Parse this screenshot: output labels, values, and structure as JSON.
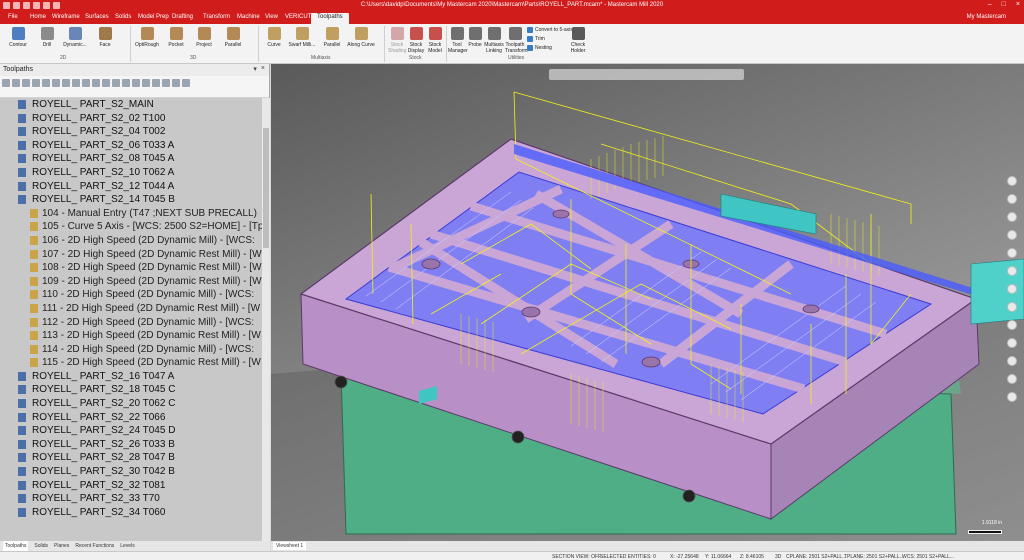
{
  "window": {
    "title": "C:\\Users\\davidp\\Documents\\My Mastercam 2020\\Mastercam\\Parts\\ROYELL_PART.mcam* - Mastercam Mill 2020",
    "controls": [
      "–",
      "□",
      "×"
    ]
  },
  "menu_tabs": [
    "File",
    "Home",
    "Wireframe",
    "Surfaces",
    "Solids",
    "Model Prep",
    "Drafting",
    "Transform",
    "Machine",
    "View",
    "VERICUT",
    "Toolpaths"
  ],
  "active_tab": "Toolpaths",
  "account": "My Mastercam",
  "ribbon": {
    "groups": {
      "g2d": "2D",
      "g3d": "3D",
      "multiaxis": "Multiaxis",
      "stock": "Stock",
      "utilities": "Utilities"
    },
    "buttons_2d": [
      "Contour",
      "Drill",
      "Dynamic...",
      "Face"
    ],
    "buttons_3d": [
      "OptiRough",
      "Pocket",
      "Project",
      "Parallel"
    ],
    "buttons_multiaxis": [
      "Curve",
      "Swarf Milli...",
      "Parallel",
      "Along Curve"
    ],
    "buttons_stock": [
      "Stock Shading",
      "Stock Display",
      "Stock Model"
    ],
    "buttons_utilities": [
      "Tool Manager",
      "Probe",
      "Multiaxis Linking",
      "Toolpath Transform"
    ],
    "small_items": [
      "Convert to 5-axis",
      "Trim",
      "Nesting"
    ],
    "check_holder": "Check Holder"
  },
  "toolpaths_panel": {
    "title": "Toolpaths",
    "rows": [
      {
        "text": "ROYELL_ PART_S2_MAIN",
        "sub": false
      },
      {
        "text": "ROYELL_ PART_S2_02 T100",
        "sub": false
      },
      {
        "text": "ROYELL_ PART_S2_04 T002",
        "sub": false
      },
      {
        "text": "ROYELL_ PART_S2_06 T033 A",
        "sub": false
      },
      {
        "text": "ROYELL_ PART_S2_08 T045 A",
        "sub": false
      },
      {
        "text": "ROYELL_ PART_S2_10 T062 A",
        "sub": false
      },
      {
        "text": "ROYELL_ PART_S2_12 T044 A",
        "sub": false
      },
      {
        "text": "ROYELL_ PART_S2_14 T045 B",
        "sub": false
      },
      {
        "text": "104 - Manual Entry (T47 ;NEXT SUB PRECALL)",
        "sub": true
      },
      {
        "text": "105 - Curve 5 Axis - [WCS: 2500 S2=HOME] - [Tp",
        "sub": true
      },
      {
        "text": "106 - 2D High Speed (2D Dynamic Mill) - [WCS:",
        "sub": true
      },
      {
        "text": "107 - 2D High Speed (2D Dynamic Rest Mill) - [W",
        "sub": true
      },
      {
        "text": "108 - 2D High Speed (2D Dynamic Rest Mill) - [W",
        "sub": true
      },
      {
        "text": "109 - 2D High Speed (2D Dynamic Rest Mill) - [W",
        "sub": true
      },
      {
        "text": "110 - 2D High Speed (2D Dynamic Mill) - [WCS:",
        "sub": true
      },
      {
        "text": "111 - 2D High Speed (2D Dynamic Rest Mill) - [W",
        "sub": true
      },
      {
        "text": "112 - 2D High Speed (2D Dynamic Mill) - [WCS:",
        "sub": true
      },
      {
        "text": "113 - 2D High Speed (2D Dynamic Rest Mill) - [W",
        "sub": true
      },
      {
        "text": "114 - 2D High Speed (2D Dynamic Mill) - [WCS:",
        "sub": true
      },
      {
        "text": "115 - 2D High Speed (2D Dynamic Rest Mill) - [W",
        "sub": true
      },
      {
        "text": "ROYELL_ PART_S2_16 T047 A",
        "sub": false
      },
      {
        "text": "ROYELL_ PART_S2_18 T045 C",
        "sub": false
      },
      {
        "text": "ROYELL_ PART_S2_20 T062 C",
        "sub": false
      },
      {
        "text": "ROYELL_ PART_S2_22 T066",
        "sub": false
      },
      {
        "text": "ROYELL_ PART_S2_24 T045 D",
        "sub": false
      },
      {
        "text": "ROYELL_ PART_S2_26 T033 B",
        "sub": false
      },
      {
        "text": "ROYELL_ PART_S2_28 T047 B",
        "sub": false
      },
      {
        "text": "ROYELL_ PART_S2_30 T042 B",
        "sub": false
      },
      {
        "text": "ROYELL_ PART_S2_32 T081",
        "sub": false
      },
      {
        "text": "ROYELL_ PART_S2_33 T70",
        "sub": false
      },
      {
        "text": "ROYELL_ PART_S2_34 T060",
        "sub": false
      }
    ]
  },
  "manager_tabs": [
    "Toolpaths",
    "Solids",
    "Planes",
    "Recent Functions",
    "Levels"
  ],
  "viewsheet_tab": "Viewsheet 1",
  "scale_label": "1.9118 in",
  "status": {
    "section_view": "SECTION VIEW: OFF",
    "selected": "SELECTED ENTITIES: 0",
    "x": "X:   -27.25648",
    "y": "Y:   11.06664",
    "z": "Z:   8.46105",
    "mode": "3D",
    "cplane": "CPLANE: 2501 S2+PALL...",
    "tplane": "TPLANE: 2501 S2+PALL...",
    "wcs": "WCS: 2501 S2+PALL..."
  },
  "colors": {
    "accent": "#d11c1c",
    "part": "#c9a6d6",
    "fixture": "#55b58a",
    "toolpath_yellow": "#f2f21a",
    "toolpath_blue": "#4a5cff"
  }
}
